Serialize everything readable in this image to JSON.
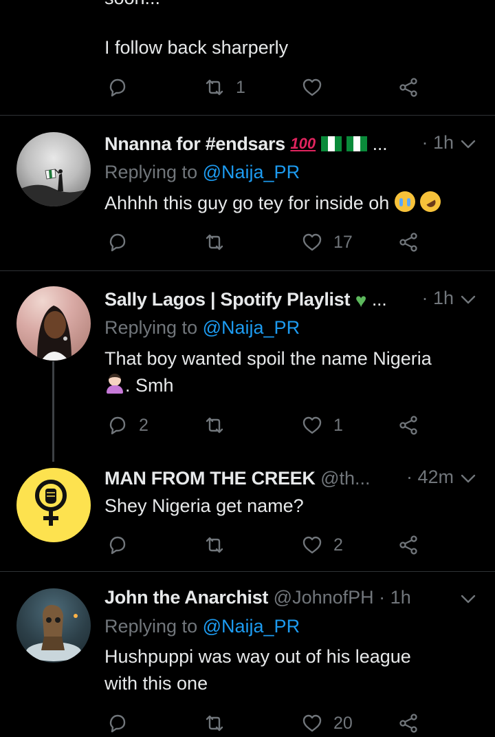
{
  "tweet0": {
    "partial_text": "soon...",
    "text": "I follow back sharperly",
    "retweets": "1",
    "likes": ""
  },
  "tweet1": {
    "name": "Nnanna for #endsars",
    "name_suffix": "...",
    "dot": "·",
    "time": "1h",
    "replying_prefix": "Replying to",
    "replying_to": "@Naija_PR",
    "text": "Ahhhh this guy go tey for inside oh",
    "replies": "",
    "retweets": "",
    "likes": "17",
    "emoji": [
      "hundred-points-emoji",
      "nigeria-flag-emoji",
      "nigeria-flag-emoji",
      "crying-face-emoji",
      "rolling-laughing-emoji"
    ]
  },
  "tweet2": {
    "name": "Sally Lagos | Spotify Playlist",
    "name_suffix": "...",
    "dot": "·",
    "time": "1h",
    "replying_prefix": "Replying to",
    "replying_to": "@Naija_PR",
    "text_line1": "That boy wanted spoil the name Nigeria",
    "text_line2": ". Smh",
    "replies": "2",
    "retweets": "",
    "likes": "1",
    "emoji": [
      "green-heart-emoji",
      "woman-tipping-hand-emoji"
    ]
  },
  "tweet3": {
    "name": "MAN FROM THE CREEK",
    "handle": "@th...",
    "dot": "·",
    "time": "42m",
    "text": "Shey Nigeria get name?",
    "replies": "",
    "retweets": "",
    "likes": "2"
  },
  "tweet4": {
    "name": "John the Anarchist",
    "handle": "@JohnofPH",
    "dot": "·",
    "time": "1h",
    "replying_prefix": "Replying to",
    "replying_to": "@Naija_PR",
    "text_line1": "Hushpuppi was way out of his league",
    "text_line2": "with this one",
    "replies": "",
    "retweets": "",
    "likes": "20"
  },
  "colors": {
    "background": "#000000",
    "accent": "#1d9bf0",
    "muted": "#71767b",
    "text": "#e7e9ea",
    "divider": "#2f3336",
    "avatar_yellow": "#fde24f"
  }
}
